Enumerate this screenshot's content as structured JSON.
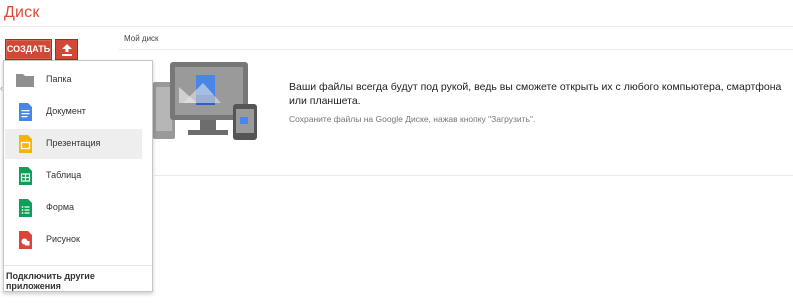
{
  "app": {
    "title": "Диск"
  },
  "toolbar": {
    "create_label": "СОЗДАТЬ",
    "upload_icon": "upload-icon"
  },
  "breadcrumb": {
    "label": "Мой диск"
  },
  "menu": {
    "items": [
      {
        "label": "Папка",
        "icon": "folder-icon",
        "color": "#8f8f8f"
      },
      {
        "label": "Документ",
        "icon": "document-icon",
        "color": "#4a86e8"
      },
      {
        "label": "Презентация",
        "icon": "presentation-icon",
        "color": "#f4b400"
      },
      {
        "label": "Таблица",
        "icon": "spreadsheet-icon",
        "color": "#0f9d58"
      },
      {
        "label": "Форма",
        "icon": "form-icon",
        "color": "#0f9d58"
      },
      {
        "label": "Рисунок",
        "icon": "drawing-icon",
        "color": "#db4437"
      }
    ],
    "footer_label": "Подключить другие приложения"
  },
  "empty_state": {
    "main_text": "Ваши файлы всегда будут под рукой, ведь вы сможете открыть их с любого компьютера, смартфона или планшета.",
    "hint_text": "Сохраните файлы на Google Диске, нажав кнопку \"Загрузить\"."
  },
  "colors": {
    "brand": "#dd4b39",
    "button": "#d14836"
  }
}
